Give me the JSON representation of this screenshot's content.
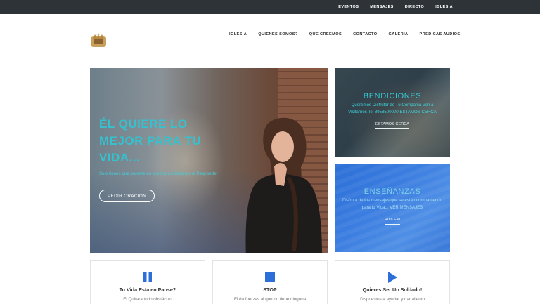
{
  "topbar": {
    "links": [
      "EVENTOS",
      "MENSAJES",
      "DIRECTO",
      "IGLESIA"
    ]
  },
  "nav": {
    "links": [
      "IGLESIA",
      "QUIENES SOMOS?",
      "QUE CREEMOS",
      "CONTACTO",
      "GALERÍA",
      "PREDICAS AUDIOS"
    ]
  },
  "hero": {
    "title": "ÉL QUIERE LO MEJOR PARA TU VIDA...",
    "subtitle": "Solo tienes que ponerte en sus manos Déjanos el Responder",
    "button": "PEDIR ORACIÓN"
  },
  "cards": [
    {
      "title": "BENDICIONES",
      "text": "Queremos Disfrutar de Tu Compañia Ven a Visitarnos Tel 8958500000 ESTAMOS CERCA",
      "link": "ESTAMOS CERCA"
    },
    {
      "title": "ENSEÑANZAS",
      "text": "Disfruta de los mensajes que se están compartiendo para tu Vida... VER MENSAJES",
      "link": "Ruta Fiel"
    }
  ],
  "features": [
    {
      "icon": "pause-icon",
      "title": "Tu Vida Esta en Pause?",
      "text": "El Quitara todo obstáculo"
    },
    {
      "icon": "stop-icon",
      "title": "STOP",
      "text": "El da fuerzas al que no tiene ninguna"
    },
    {
      "icon": "play-icon",
      "title": "Quieres Ser Un Soldado!",
      "text": "Dispuestos a ayudar y dar aliento"
    }
  ],
  "colors": {
    "topbar": "#2e3338",
    "accent_teal": "#35c2cf",
    "icon_blue": "#2d6fd8"
  }
}
